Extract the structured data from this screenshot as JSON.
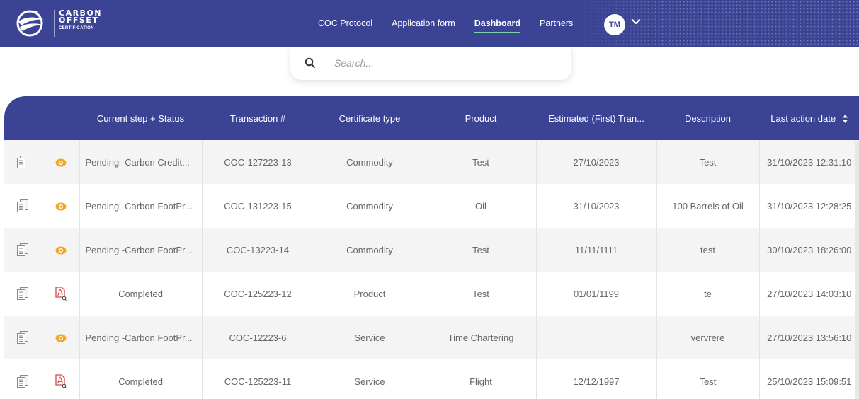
{
  "brand": {
    "line1": "CARBON",
    "line2": "OFFSET",
    "line3": "CERTIFICATION",
    "color": "#3b4494",
    "accent": "#7fd0a3"
  },
  "nav": {
    "items": [
      {
        "label": "COC Protocol",
        "active": false
      },
      {
        "label": "Application form",
        "active": false
      },
      {
        "label": "Dashboard",
        "active": true
      },
      {
        "label": "Partners",
        "active": false
      }
    ],
    "avatar_initials": "TM"
  },
  "search": {
    "placeholder": "Search...",
    "value": ""
  },
  "table": {
    "columns": [
      "",
      "",
      "Current step + Status",
      "Transaction #",
      "Certificate type",
      "Product",
      "Estimated (First) Tran...",
      "Description",
      "Last action date"
    ],
    "sort_column": "Last action date",
    "rows": [
      {
        "action_icon": "eye-icon",
        "status": "Pending -Carbon Credit...",
        "transaction": "COC-127223-13",
        "certificate_type": "Commodity",
        "product": "Test",
        "estimated": "27/10/2023",
        "description": "Test",
        "last_action": "31/10/2023 12:31:10"
      },
      {
        "action_icon": "eye-icon",
        "status": "Pending -Carbon FootPr...",
        "transaction": "COC-131223-15",
        "certificate_type": "Commodity",
        "product": "Oil",
        "estimated": "31/10/2023",
        "description": "100 Barrels of Oil",
        "last_action": "31/10/2023 12:28:25"
      },
      {
        "action_icon": "eye-icon",
        "status": "Pending -Carbon FootPr...",
        "transaction": "COC-13223-14",
        "certificate_type": "Commodity",
        "product": "Test",
        "estimated": "11/11/1111",
        "description": "test",
        "last_action": "30/10/2023 18:26:00"
      },
      {
        "action_icon": "pdf-icon",
        "status": "Completed",
        "transaction": "COC-125223-12",
        "certificate_type": "Product",
        "product": "Test",
        "estimated": "01/01/1199",
        "description": "te",
        "last_action": "27/10/2023 14:03:10"
      },
      {
        "action_icon": "eye-icon",
        "status": "Pending -Carbon FootPr...",
        "transaction": "COC-12223-6",
        "certificate_type": "Service",
        "product": "Time Chartering",
        "estimated": "",
        "description": "vervrere",
        "last_action": "27/10/2023 13:56:10"
      },
      {
        "action_icon": "pdf-icon",
        "status": "Completed",
        "transaction": "COC-125223-11",
        "certificate_type": "Service",
        "product": "Flight",
        "estimated": "12/12/1997",
        "description": "Test",
        "last_action": "25/10/2023 15:09:51"
      }
    ]
  }
}
